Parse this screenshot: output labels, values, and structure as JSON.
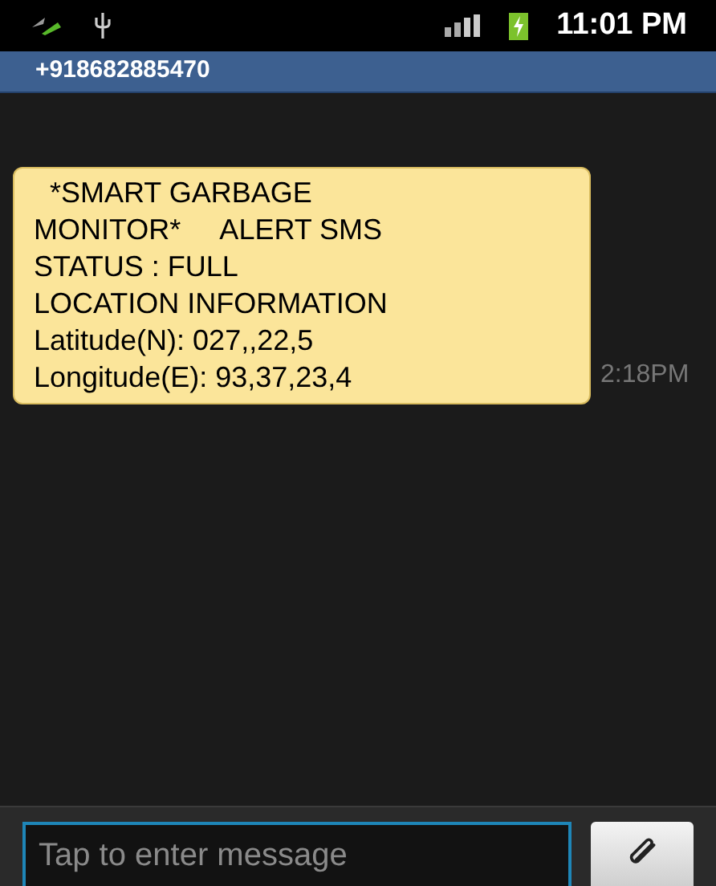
{
  "status_bar": {
    "time": "11:01 PM"
  },
  "header": {
    "title": "+918682885470"
  },
  "messages": [
    {
      "lines": [
        "  *SMART GARBAGE",
        "MONITOR*     ALERT SMS",
        "STATUS : FULL",
        "LOCATION INFORMATION",
        "Latitude(N): 027,,22,5",
        "Longitude(E): 93,37,23,4"
      ],
      "time": "2:18PM"
    }
  ],
  "composer": {
    "placeholder": "Tap to enter message"
  }
}
